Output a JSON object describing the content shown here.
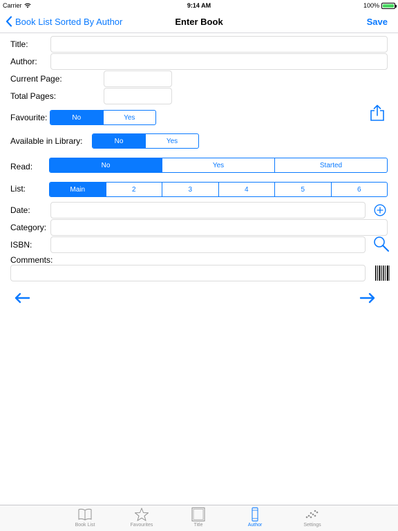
{
  "status": {
    "carrier": "Carrier",
    "time": "9:14 AM",
    "battery": "100%",
    "battery_level": 1.0
  },
  "nav": {
    "back_label": "Book List Sorted By Author",
    "title": "Enter Book",
    "save_label": "Save"
  },
  "form": {
    "title_label": "Title:",
    "author_label": "Author:",
    "current_page_label": "Current Page:",
    "total_pages_label": "Total Pages:",
    "favourite_label": "Favourite:",
    "library_label": "Available in Library:",
    "read_label": "Read:",
    "list_label": "List:",
    "date_label": "Date:",
    "category_label": "Category:",
    "isbn_label": "ISBN:",
    "comments_label": "Comments:",
    "title_value": "",
    "author_value": "",
    "current_page_value": "",
    "total_pages_value": "",
    "date_value": "",
    "category_value": "",
    "isbn_value": "",
    "comments_value": ""
  },
  "segments": {
    "favourite": {
      "options": [
        "No",
        "Yes"
      ],
      "selected": "No"
    },
    "library": {
      "options": [
        "No",
        "Yes"
      ],
      "selected": "No"
    },
    "read": {
      "options": [
        "No",
        "Yes",
        "Started"
      ],
      "selected": "No"
    },
    "list": {
      "options": [
        "Main",
        "2",
        "3",
        "4",
        "5",
        "6"
      ],
      "selected": "Main"
    }
  },
  "icons": {
    "share": "share-icon",
    "add_date": "plus-circle-icon",
    "search": "magnifier-icon",
    "barcode": "barcode-icon",
    "prev": "arrow-left-icon",
    "next": "arrow-right-icon"
  },
  "colors": {
    "accent": "#0a7aff",
    "inactive": "#929292",
    "border": "#dcdcdc"
  },
  "tabs": [
    {
      "label": "Book List",
      "icon": "open-book-icon",
      "active": false
    },
    {
      "label": "Favourites",
      "icon": "star-icon",
      "active": false
    },
    {
      "label": "Title",
      "icon": "book-cover-icon",
      "active": false
    },
    {
      "label": "Author",
      "icon": "book-spine-icon",
      "active": true
    },
    {
      "label": "Settings",
      "icon": "dots-icon",
      "active": false
    }
  ]
}
